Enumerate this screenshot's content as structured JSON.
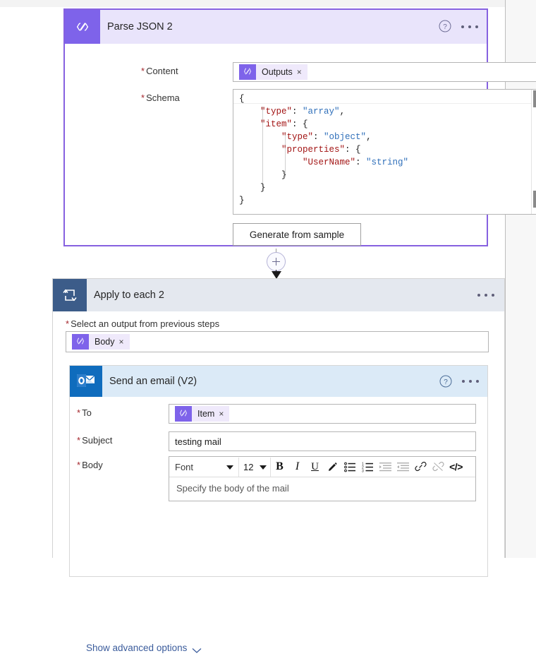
{
  "page": {
    "background": "#ffffff",
    "accent_purple": "#7e63ea",
    "accent_blue": "#0f6cbd",
    "loop_blue": "#3c5c89",
    "required_mark": "*"
  },
  "parse_json_card": {
    "icon": "json-braces-icon",
    "title": "Parse JSON 2",
    "help_icon": "help-circle-icon",
    "menu_icon": "more-options-icon",
    "border_color": "#8661e0",
    "header_color": "#e9e4fb",
    "content_field": {
      "label": "Content",
      "required": true,
      "token": {
        "icon": "expression-icon",
        "label": "Outputs",
        "remove": "×"
      }
    },
    "schema_field": {
      "label": "Schema",
      "required": true,
      "lines": [
        "{",
        "    \"type\": \"array\",",
        "    \"item\": {",
        "        \"type\": \"object\",",
        "        \"properties\": {",
        "            \"UserName\": \"string\"",
        "        }",
        "    }",
        "}"
      ]
    },
    "generate_button": "Generate from sample"
  },
  "connector": {
    "add_icon": "plus-circle-icon",
    "arrow_icon": "arrow-down-icon"
  },
  "apply_to_each_card": {
    "icon": "loop-icon",
    "title": "Apply to each 2",
    "menu_icon": "more-options-icon",
    "header_color": "#e4e8ef",
    "select_output": {
      "label": "Select an output from previous steps",
      "required": true,
      "token": {
        "icon": "expression-icon",
        "label": "Body",
        "remove": "×"
      }
    }
  },
  "send_email_card": {
    "icon": "outlook-icon",
    "title": "Send an email (V2)",
    "help_icon": "help-circle-icon",
    "menu_icon": "more-options-icon",
    "header_color": "#dbeaf7",
    "to_field": {
      "label": "To",
      "required": true,
      "token": {
        "icon": "expression-icon",
        "label": "Item",
        "remove": "×"
      }
    },
    "subject_field": {
      "label": "Subject",
      "required": true,
      "value": "testing mail"
    },
    "body_field": {
      "label": "Body",
      "required": true,
      "placeholder": "Specify the body of the mail",
      "toolbar": {
        "font_name": "Font",
        "font_size": "12",
        "bold": "B",
        "italic": "I",
        "underline": "U",
        "code": "</>",
        "icons": [
          "highlighter-icon",
          "bulleted-list-icon",
          "numbered-list-icon",
          "indent-icon",
          "outdent-icon",
          "link-icon",
          "unlink-icon",
          "code-view-icon"
        ]
      }
    },
    "show_advanced": {
      "label": "Show advanced options",
      "chevron": "chevron-down-icon"
    }
  }
}
